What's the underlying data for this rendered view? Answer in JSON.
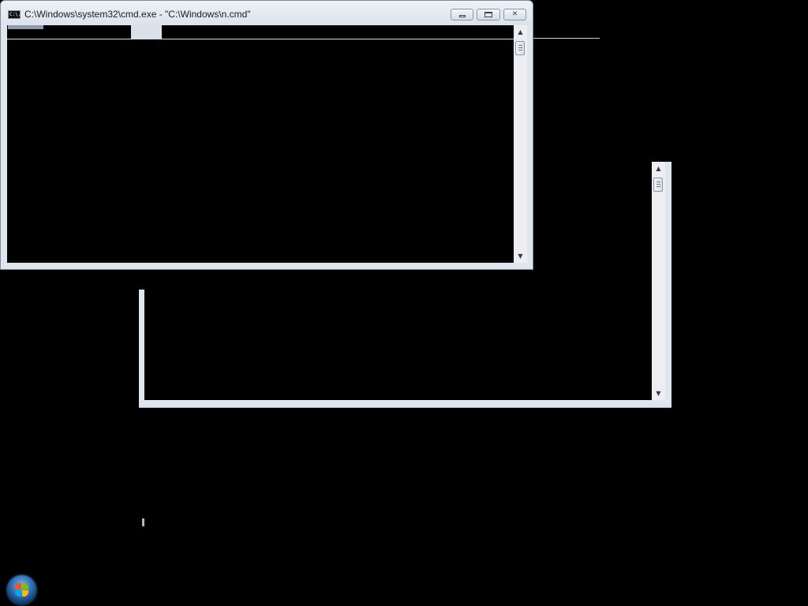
{
  "cmd_window": {
    "title": "C:\\Windows\\system32\\cmd.exe - \"C:\\Windows\\n.cmd\"",
    "icon_text": "C:\\.",
    "buttons": {
      "minimize": "minimize",
      "maximize": "maximize",
      "close": "✕"
    },
    "scrollbar": {
      "up_arrow": "▲",
      "down_arrow": "▼"
    }
  },
  "ghost_window": {
    "scrollbar": {
      "up_arrow": "▲",
      "down_arrow": "▼"
    }
  },
  "taskbar": {
    "start_orb": "windows-start-orb-icon"
  },
  "colors": {
    "desktop_background": "#000000",
    "window_frame": "#dfe6ee",
    "console_background": "#000000"
  }
}
